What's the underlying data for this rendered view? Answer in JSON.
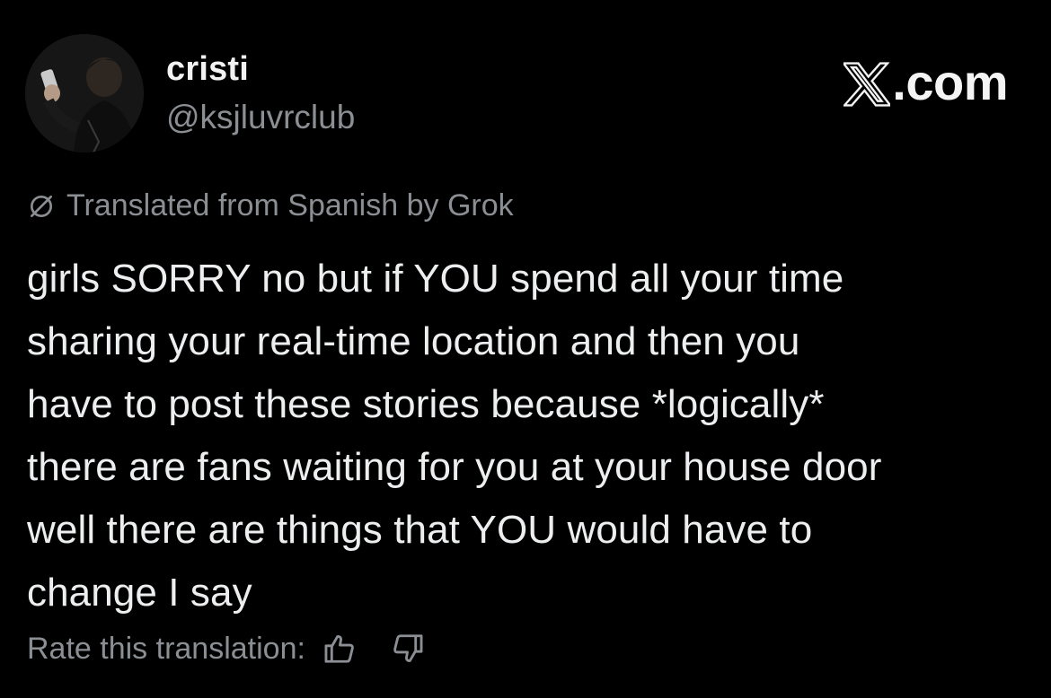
{
  "author": {
    "display_name": "cristi",
    "handle": "@ksjluvrclub",
    "avatar_icon": "profile-photo"
  },
  "brand": {
    "domain_text": ".com",
    "logo_icon": "x-logo-icon"
  },
  "translation": {
    "notice": "Translated from Spanish by Grok",
    "icon": "translate-icon"
  },
  "post": {
    "lines": [
      "girls SORRY no but if YOU spend all your time",
      "sharing your real-time location and then you",
      "have to post these stories because *logically*",
      "there are fans waiting for you at your house door",
      "well there are things that YOU would have to",
      "change I say"
    ]
  },
  "rating": {
    "label": "Rate this translation:",
    "thumbs_up_icon": "thumbs-up-icon",
    "thumbs_down_icon": "thumbs-down-icon"
  },
  "colors": {
    "background": "#000000",
    "primary_text": "#e7e9ea",
    "secondary_text": "#8b8f94"
  }
}
